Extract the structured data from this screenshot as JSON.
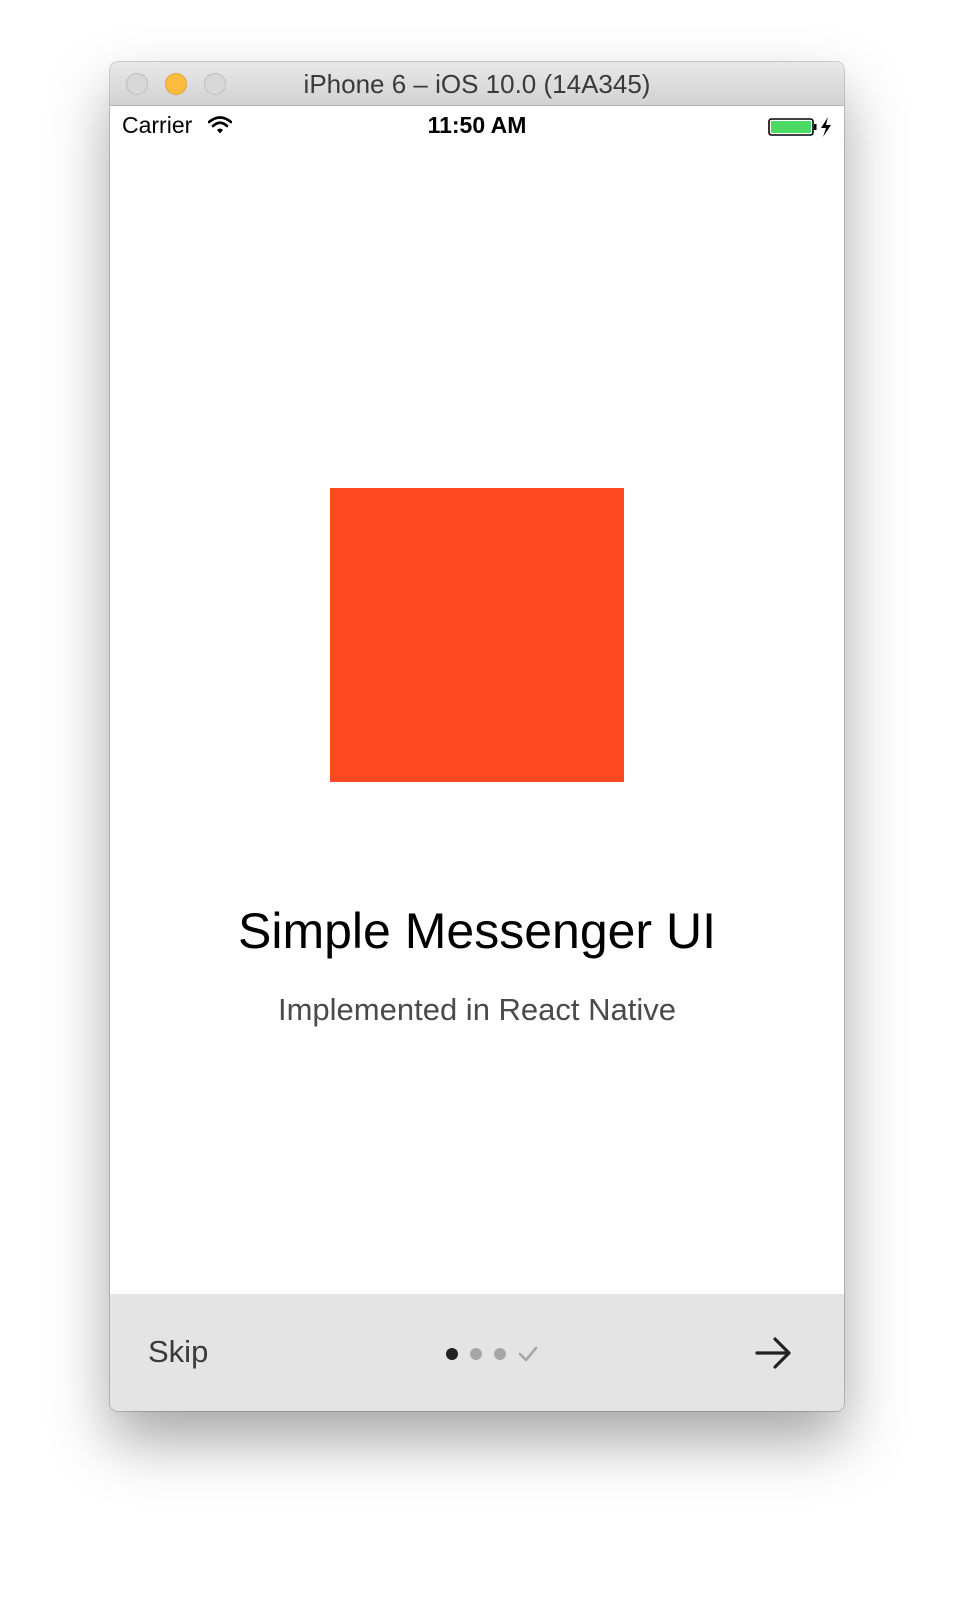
{
  "window": {
    "title": "iPhone 6 – iOS 10.0 (14A345)"
  },
  "status_bar": {
    "carrier": "Carrier",
    "time": "11:50 AM",
    "wifi_icon": "wifi-icon",
    "battery_icon": "battery-charging-icon",
    "battery_color": "#4cd964"
  },
  "slide": {
    "image_color": "#fc4921",
    "title": "Simple Messenger UI",
    "subtitle": "Implemented in React Native"
  },
  "footer": {
    "skip_label": "Skip",
    "page_count": 3,
    "current_page": 1,
    "done_icon": "checkmark-icon",
    "next_icon": "arrow-right-icon"
  }
}
